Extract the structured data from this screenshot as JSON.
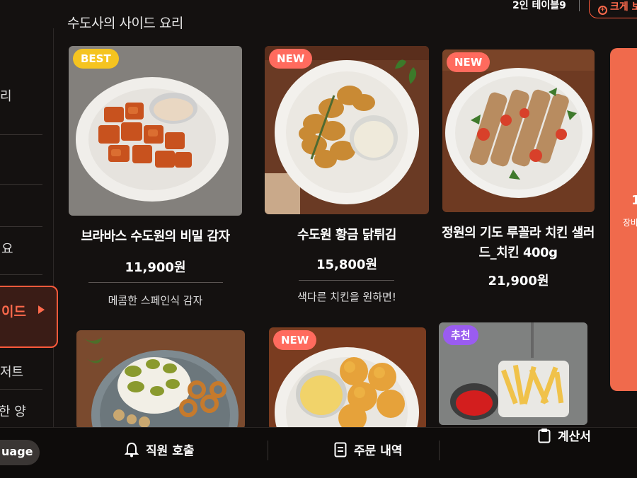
{
  "header": {
    "section_title": "수도사의 사이드 요리",
    "table_name": "2인 테이블9",
    "zoom_label": "크게 보"
  },
  "sidebar": {
    "items": [
      "리",
      "요",
      "이드",
      "저트",
      "한 양"
    ]
  },
  "menu": [
    {
      "badge": "BEST",
      "name": "브라바스 수도원의 비밀 감자",
      "price": "11,900원",
      "desc": "메콤한 스페인식 감자"
    },
    {
      "badge": "NEW",
      "name": "수도원 황금 닭튀김",
      "price": "15,800원",
      "desc": "색다른 치킨을 원하면!"
    },
    {
      "badge": "NEW",
      "name_line1": "정원의 기도 루꼴라 치킨 샐러",
      "name_line2": "드_치킨 400g",
      "price": "21,900원"
    },
    {
      "badge": ""
    },
    {
      "badge": "NEW"
    },
    {
      "badge": "추천"
    }
  ],
  "right_panel": {
    "line1": "1",
    "line2": "장바"
  },
  "bottom": {
    "language_label": "uage",
    "call_staff": "직원 호출",
    "order_history": "주문 내역",
    "bill": "계산서"
  },
  "colors": {
    "accent": "#ff5a3c",
    "best": "#f5c420",
    "new": "#ff6b5e",
    "recommend": "#9a5cf0"
  }
}
